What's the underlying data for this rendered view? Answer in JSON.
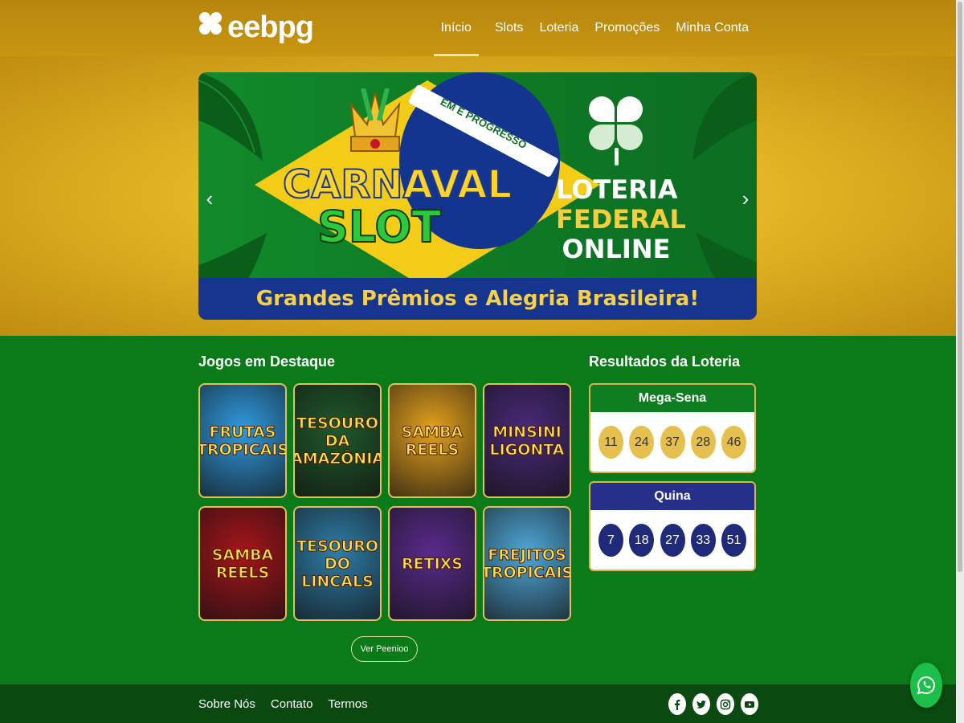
{
  "brand": {
    "name": "eebpg"
  },
  "nav": {
    "items": [
      {
        "label": "Início",
        "active": true
      },
      {
        "label": "Slots",
        "active": false
      },
      {
        "label": "Loteria",
        "active": false
      },
      {
        "label": "Promoções",
        "active": false
      },
      {
        "label": "Minha Conta",
        "active": false
      }
    ]
  },
  "hero": {
    "motto": "EM E PROGRESSO",
    "slot_title_1": "CARNAVAL",
    "slot_title_2": "SLOT",
    "lottery_1": "LOTERIA",
    "lottery_2": "FEDERAL",
    "lottery_3": "ONLINE",
    "tagline": "Grandes Prêmios e Alegria Brasileira!",
    "prev_icon": "chevron-left-icon",
    "next_icon": "chevron-right-icon"
  },
  "featured": {
    "title": "Jogos em Destaque",
    "games": [
      {
        "name": "FRUTAS TROPICAIS",
        "bg": "#2f9be0"
      },
      {
        "name": "TESOURO DA AMAZÔNIA",
        "bg": "#1f5a2a"
      },
      {
        "name": "SAMBA REELS",
        "bg": "#e5a21c"
      },
      {
        "name": "MINSINI LIGONTA",
        "bg": "#4a2a7a"
      },
      {
        "name": "SAMBA REELS",
        "bg": "#a8141a"
      },
      {
        "name": "TESOURO DO LINCALS",
        "bg": "#2e7ea8"
      },
      {
        "name": "RETIXS",
        "bg": "#5a2a8c"
      },
      {
        "name": "FREJITOS TROPICAIS",
        "bg": "#4fa8d8"
      }
    ],
    "more_label": "Ver Peenioo"
  },
  "results": {
    "title": "Resultados da Loteria",
    "mega": {
      "name": "Mega-Sena",
      "color": "#0e7d1f",
      "numbers": [
        "11",
        "24",
        "37",
        "28",
        "46"
      ]
    },
    "quina": {
      "name": "Quina",
      "color": "#262f8a",
      "numbers": [
        "7",
        "18",
        "27",
        "33",
        "51"
      ]
    }
  },
  "footer": {
    "links": [
      "Sobre Nós",
      "Contato",
      "Termos"
    ],
    "socials": [
      "facebook-icon",
      "twitter-icon",
      "instagram-icon",
      "youtube-icon"
    ]
  },
  "floating": {
    "icon": "whatsapp-icon"
  }
}
